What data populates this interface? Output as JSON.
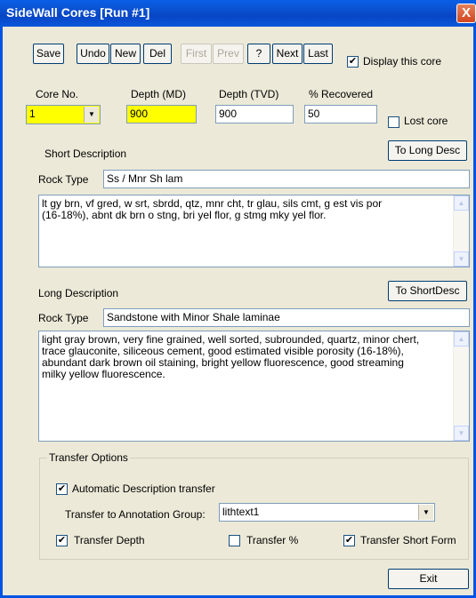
{
  "window": {
    "title": "SideWall Cores [Run #1]",
    "close_glyph": "X"
  },
  "toolbar": {
    "save": "Save",
    "undo": "Undo",
    "new": "New",
    "del": "Del",
    "first": "First",
    "prev": "Prev",
    "help": "?",
    "next": "Next",
    "last": "Last",
    "display_label": "Display this core",
    "display_checked": true
  },
  "fields": {
    "core_no_label": "Core No.",
    "core_no_value": "1",
    "depth_md_label": "Depth (MD)",
    "depth_md_value": "900",
    "depth_tvd_label": "Depth (TVD)",
    "depth_tvd_value": "900",
    "recovered_label": "% Recovered",
    "recovered_value": "50",
    "lost_core_label": "Lost core",
    "lost_core_checked": false
  },
  "short_desc": {
    "heading": "Short Description",
    "to_long_button": "To Long Desc",
    "rock_type_label": "Rock Type",
    "rock_type_value": "Ss / Mnr Sh lam",
    "text": "lt gy brn, vf gred, w srt, sbrdd, qtz, mnr cht, tr glau, sils cmt, g est vis por\n(16-18%), abnt dk brn o stng, bri yel flor, g stmg mky yel flor."
  },
  "long_desc": {
    "heading": "Long Description",
    "to_short_button": "To ShortDesc",
    "rock_type_label": "Rock Type",
    "rock_type_value": "Sandstone with Minor Shale laminae",
    "text": "light gray brown, very fine grained, well sorted, subrounded, quartz, minor chert,\ntrace glauconite, siliceous cement, good estimated visible porosity (16-18%),\nabundant dark brown oil staining, bright yellow fluorescence, good streaming\nmilky yellow fluorescence."
  },
  "transfer": {
    "group_label": "Transfer Options",
    "auto_label": "Automatic Description transfer",
    "auto_checked": true,
    "annotation_label": "Transfer to Annotation Group:",
    "annotation_value": "lithtext1",
    "depth_label": "Transfer Depth",
    "depth_checked": true,
    "percent_label": "Transfer %",
    "percent_checked": false,
    "short_form_label": "Transfer Short Form",
    "short_form_checked": true
  },
  "exit_button": "Exit"
}
